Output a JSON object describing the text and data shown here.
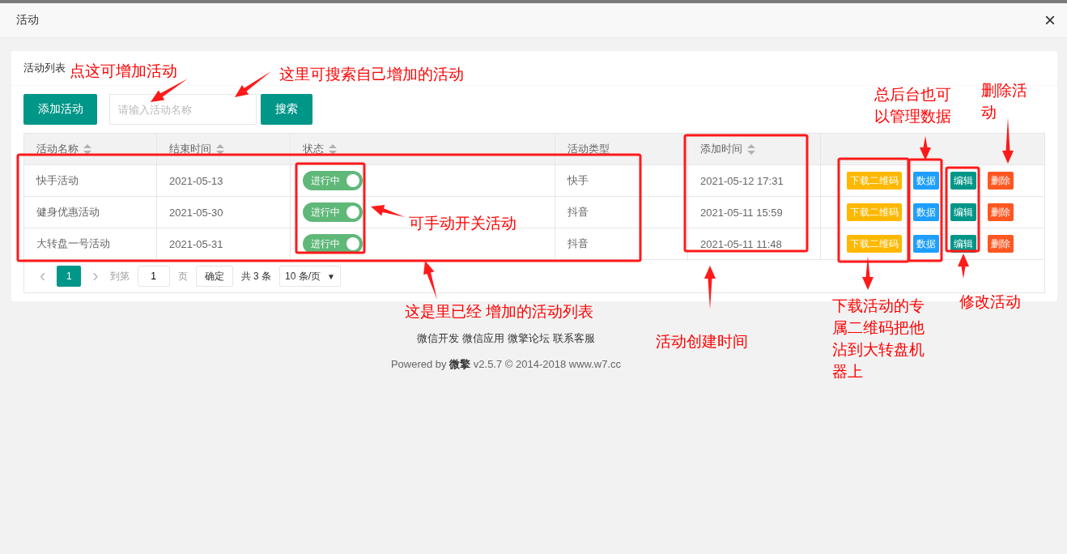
{
  "dialog": {
    "title": "活动",
    "close": "×"
  },
  "card": {
    "title": "活动列表"
  },
  "toolbar": {
    "add_button": "添加活动",
    "search": {
      "placeholder": "请输入活动名称"
    },
    "search_button": "搜索"
  },
  "table": {
    "columns": [
      {
        "label": "活动名称",
        "sortable": true
      },
      {
        "label": "结束时间",
        "sortable": true
      },
      {
        "label": "状态",
        "sortable": true
      },
      {
        "label": "活动类型",
        "sortable": false
      },
      {
        "label": "添加时间",
        "sortable": true
      },
      {
        "sortable": false
      }
    ],
    "rows": [
      {
        "name": "快手活动",
        "end": "2021-05-13",
        "status": {
          "label": "进行中",
          "on": true
        },
        "type": "快手",
        "added": "2021-05-12 17:31",
        "actions": [
          {
            "kind": "download",
            "label": "下载二维码"
          },
          {
            "kind": "data",
            "label": "数据"
          },
          {
            "kind": "edit",
            "label": "编辑"
          },
          {
            "kind": "delete",
            "label": "删除"
          }
        ]
      },
      {
        "name": "健身优惠活动",
        "end": "2021-05-30",
        "status": {
          "label": "进行中",
          "on": true
        },
        "type": "抖音",
        "added": "2021-05-11 15:59",
        "actions": [
          {
            "kind": "download",
            "label": "下载二维码"
          },
          {
            "kind": "data",
            "label": "数据"
          },
          {
            "kind": "edit",
            "label": "编辑"
          },
          {
            "kind": "delete",
            "label": "删除"
          }
        ]
      },
      {
        "name": "大转盘一号活动",
        "end": "2021-05-31",
        "status": {
          "label": "进行中",
          "on": true
        },
        "type": "抖音",
        "added": "2021-05-11 11:48",
        "actions": [
          {
            "kind": "download",
            "label": "下载二维码"
          },
          {
            "kind": "data",
            "label": "数据"
          },
          {
            "kind": "edit",
            "label": "编辑"
          },
          {
            "kind": "delete",
            "label": "删除"
          }
        ]
      }
    ]
  },
  "pager": {
    "prev": "‹",
    "pages": [
      {
        "label": "1",
        "selected": true
      }
    ],
    "next": "›",
    "goto_label": "到第",
    "goto_value": "1",
    "page_unit": "页",
    "confirm": "确定",
    "total": "共 3 条",
    "page_size": "10 条/页",
    "caret": "▼"
  },
  "footer": {
    "links": [
      "微信开发",
      "微信应用",
      "微擎论坛",
      "联系客服"
    ],
    "powered": "Powered by **微擎** v2.5.7 © 2014-2018 www.w7.cc"
  },
  "annotations": [
    "点这可增加活动",
    "这里可搜索自己增加的活动",
    "总后台也可以管理数据",
    "删除活动",
    "可手动开关活动",
    "这是里已经 增加的活动列表",
    "活动创建时间",
    "下载活动的专属二维码把他沾到大转盘机器上",
    "修改活动"
  ]
}
